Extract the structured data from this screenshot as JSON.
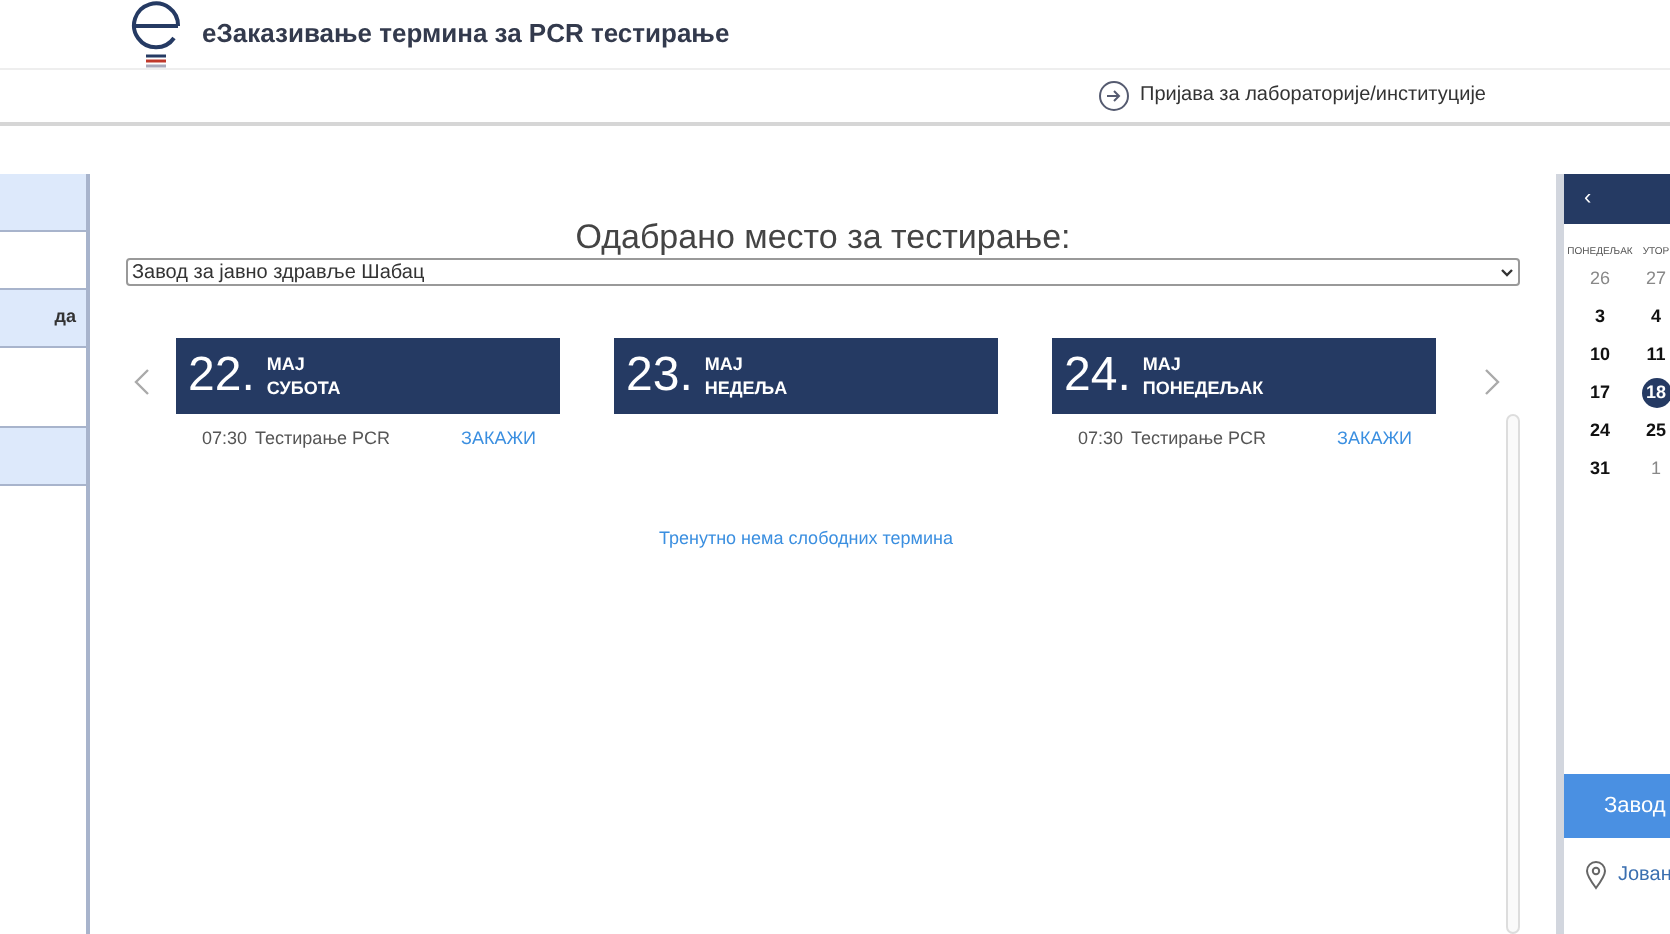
{
  "header": {
    "title": "еЗаказивање термина за PCR тестирање"
  },
  "nav": {
    "link": "Пријава за лабораторије/институције"
  },
  "sidebar": {
    "items": [
      {
        "highlighted": true
      },
      {
        "highlighted": false
      },
      {
        "highlighted": true,
        "label": "да"
      },
      {
        "highlighted": false
      },
      {
        "highlighted": true
      }
    ]
  },
  "main": {
    "heading": "Одабрано место за тестирање:",
    "location_select": {
      "value": "Завод за јавно здравље Шабац"
    },
    "days": [
      {
        "day": "22.",
        "month": "МАЈ",
        "weekday": "СУБОТА",
        "slots": [
          {
            "time": "07:30",
            "name": "Тестирање PCR",
            "action": "ЗАКАЖИ"
          }
        ]
      },
      {
        "day": "23.",
        "month": "МАЈ",
        "weekday": "НЕДЕЉА",
        "message": "Тренутно нема слободних термина"
      },
      {
        "day": "24.",
        "month": "МАЈ",
        "weekday": "ПОНЕДЕЉАК",
        "slots": [
          {
            "time": "07:30",
            "name": "Тестирање PCR",
            "action": "ЗАКАЖИ"
          }
        ]
      }
    ]
  },
  "calendar": {
    "prev": "‹",
    "weekdays": [
      "ПОНЕДЕЉАК",
      "УТОР"
    ],
    "weeks": [
      [
        {
          "d": "26",
          "outside": true,
          "selected": false
        },
        {
          "d": "27",
          "outside": true,
          "selected": false
        }
      ],
      [
        {
          "d": "3",
          "outside": false,
          "selected": false
        },
        {
          "d": "4",
          "outside": false,
          "selected": false
        }
      ],
      [
        {
          "d": "10",
          "outside": false,
          "selected": false
        },
        {
          "d": "11",
          "outside": false,
          "selected": false
        }
      ],
      [
        {
          "d": "17",
          "outside": false,
          "selected": false
        },
        {
          "d": "18",
          "outside": false,
          "selected": true
        }
      ],
      [
        {
          "d": "24",
          "outside": false,
          "selected": false
        },
        {
          "d": "25",
          "outside": false,
          "selected": false
        }
      ],
      [
        {
          "d": "31",
          "outside": false,
          "selected": false
        },
        {
          "d": "1",
          "outside": true,
          "selected": false
        }
      ]
    ]
  },
  "institution": {
    "name": "Завод",
    "address": "Јован"
  }
}
